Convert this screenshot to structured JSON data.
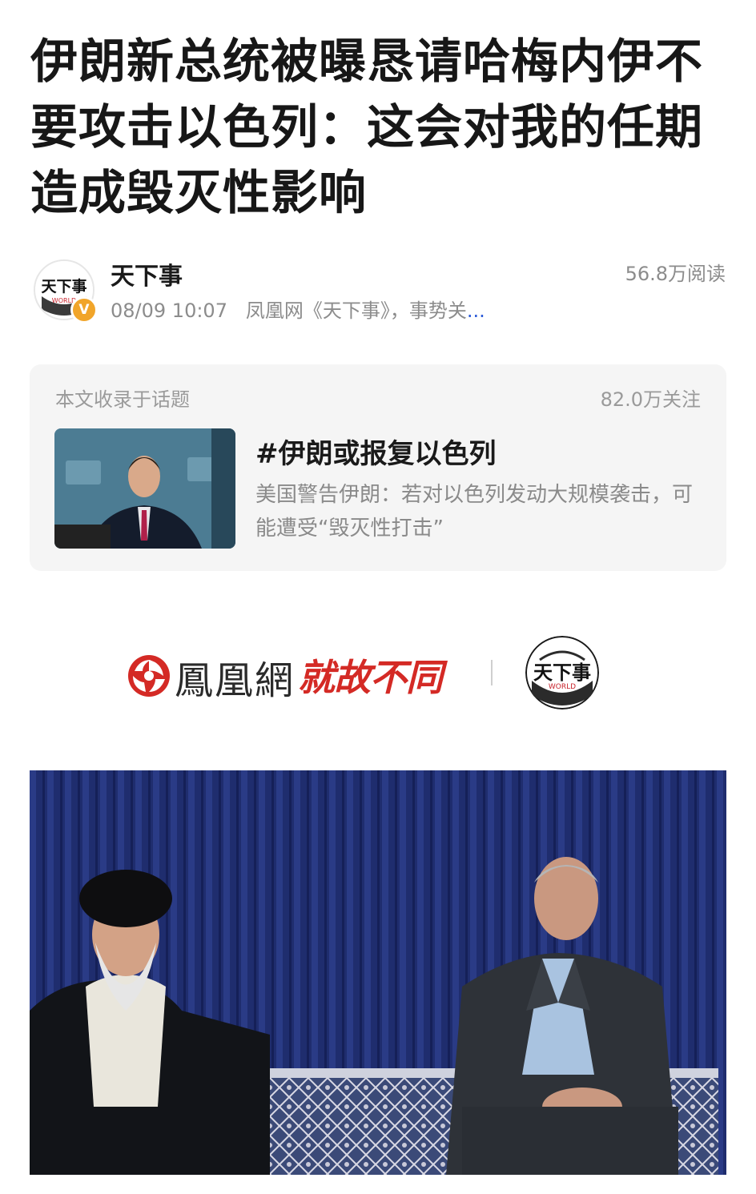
{
  "article": {
    "headline": "伊朗新总统被曝恳请哈梅内伊不要攻击以色列：这会对我的任期造成毁灭性影响"
  },
  "author": {
    "name": "天下事",
    "avatar_text": "天下事",
    "avatar_sub": "WORLD",
    "verified_glyph": "V",
    "date": "08/09 10:07",
    "meta_text": "凤凰网《天下事》，事势关",
    "more": "...",
    "read_count": "56.8万阅读"
  },
  "topic": {
    "caption": "本文收录于话题",
    "followers": "82.0万关注",
    "title": "#伊朗或报复以色列",
    "description": "美国警告伊朗：若对以色列发动大规模袭击，可能遭受“毁灭性打击”"
  },
  "brand": {
    "name": "鳳凰網",
    "slogan": "就故不同",
    "round_text": "天下事",
    "round_sub": "WORLD"
  },
  "colors": {
    "accent_red": "#d42a25",
    "link_blue": "#2b5ad8",
    "verified": "#f1a52a",
    "card_bg": "#f5f5f5"
  }
}
